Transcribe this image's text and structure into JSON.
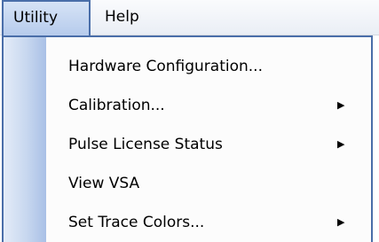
{
  "menubar": {
    "items": [
      {
        "label": "Utility",
        "active": true
      },
      {
        "label": "Help",
        "active": false
      }
    ]
  },
  "dropdown": {
    "items": [
      {
        "label": "Hardware Configuration...",
        "has_submenu": false
      },
      {
        "label": "Calibration...",
        "has_submenu": true,
        "arrow_icon": "chevron-right-icon",
        "arrow_glyph": "▶"
      },
      {
        "label": "Pulse License Status",
        "has_submenu": true,
        "arrow_icon": "chevron-right-icon",
        "arrow_glyph": "▶"
      },
      {
        "label": "View VSA",
        "has_submenu": false
      },
      {
        "label": "Set Trace Colors...",
        "has_submenu": true,
        "arrow_icon": "chevron-right-icon",
        "arrow_glyph": "▶"
      }
    ]
  },
  "colors": {
    "menu_border": "#4a6ea9",
    "active_menubar_bg": "#c4d5ef",
    "gutter": "#b9cbeb",
    "menu_bg": "#fcfcfc"
  }
}
